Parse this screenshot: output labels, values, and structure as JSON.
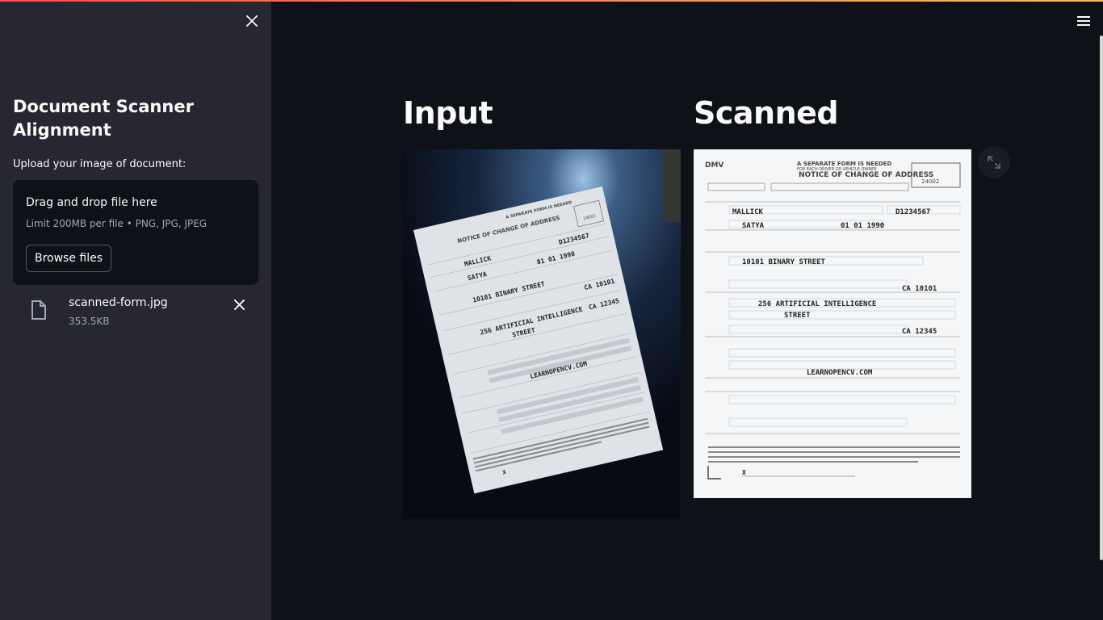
{
  "sidebar": {
    "title": "Document Scanner Alignment",
    "upload_label": "Upload your image of document:",
    "dropzone": {
      "title": "Drag and drop file here",
      "limits": "Limit 200MB per file • PNG, JPG, JPEG",
      "browse_label": "Browse files"
    },
    "file": {
      "name": "scanned-form.jpg",
      "size": "353.5KB"
    }
  },
  "main": {
    "input_title": "Input",
    "scanned_title": "Scanned"
  },
  "form": {
    "header_line1": "A SEPARATE FORM IS NEEDED",
    "header_line2": "FOR EACH DRIVER OR VEHICLE OWNER",
    "title": "NOTICE OF CHANGE OF ADDRESS",
    "dmv_number": "24002",
    "last_name": "MALLICK",
    "license": "D1234567",
    "first_name": "SATYA",
    "birthdate": "01 01 1990",
    "street1": "10101 BINARY STREET",
    "zip1": "CA 10101",
    "street2a": "256 ARTIFICIAL INTELLIGENCE",
    "street2b": "STREET",
    "zip2": "CA 12345",
    "vehicle": "LEARNOPENCV.COM",
    "signature": "X"
  },
  "icons": {
    "close": "close-icon",
    "file": "file-icon",
    "menu": "hamburger-menu-icon",
    "expand": "fullscreen-icon"
  },
  "colors": {
    "sidebar_bg": "#262730",
    "main_bg": "#0e1117",
    "accent_start": "#ff4b4b",
    "accent_end": "#ffbd45"
  }
}
